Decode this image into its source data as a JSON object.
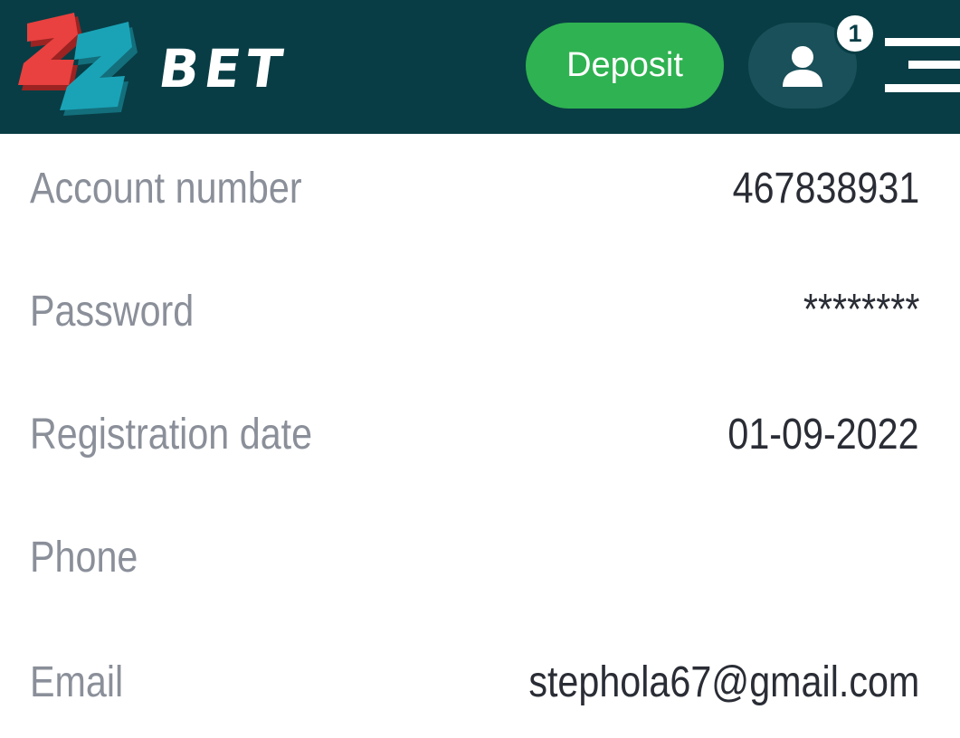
{
  "header": {
    "logo_text": "BET",
    "deposit_label": "Deposit",
    "notification_count": "1",
    "colors": {
      "background": "#083d45",
      "deposit": "#2fb251",
      "logo_red": "#e8413f",
      "logo_teal": "#1aa3b6"
    }
  },
  "account": {
    "rows": [
      {
        "label": "Account number",
        "value": "467838931"
      },
      {
        "label": "Password",
        "value": "********"
      },
      {
        "label": "Registration date",
        "value": "01-09-2022"
      },
      {
        "label": "Phone",
        "value": ""
      },
      {
        "label": "Email",
        "value": "stephola67@gmail.com"
      }
    ]
  }
}
